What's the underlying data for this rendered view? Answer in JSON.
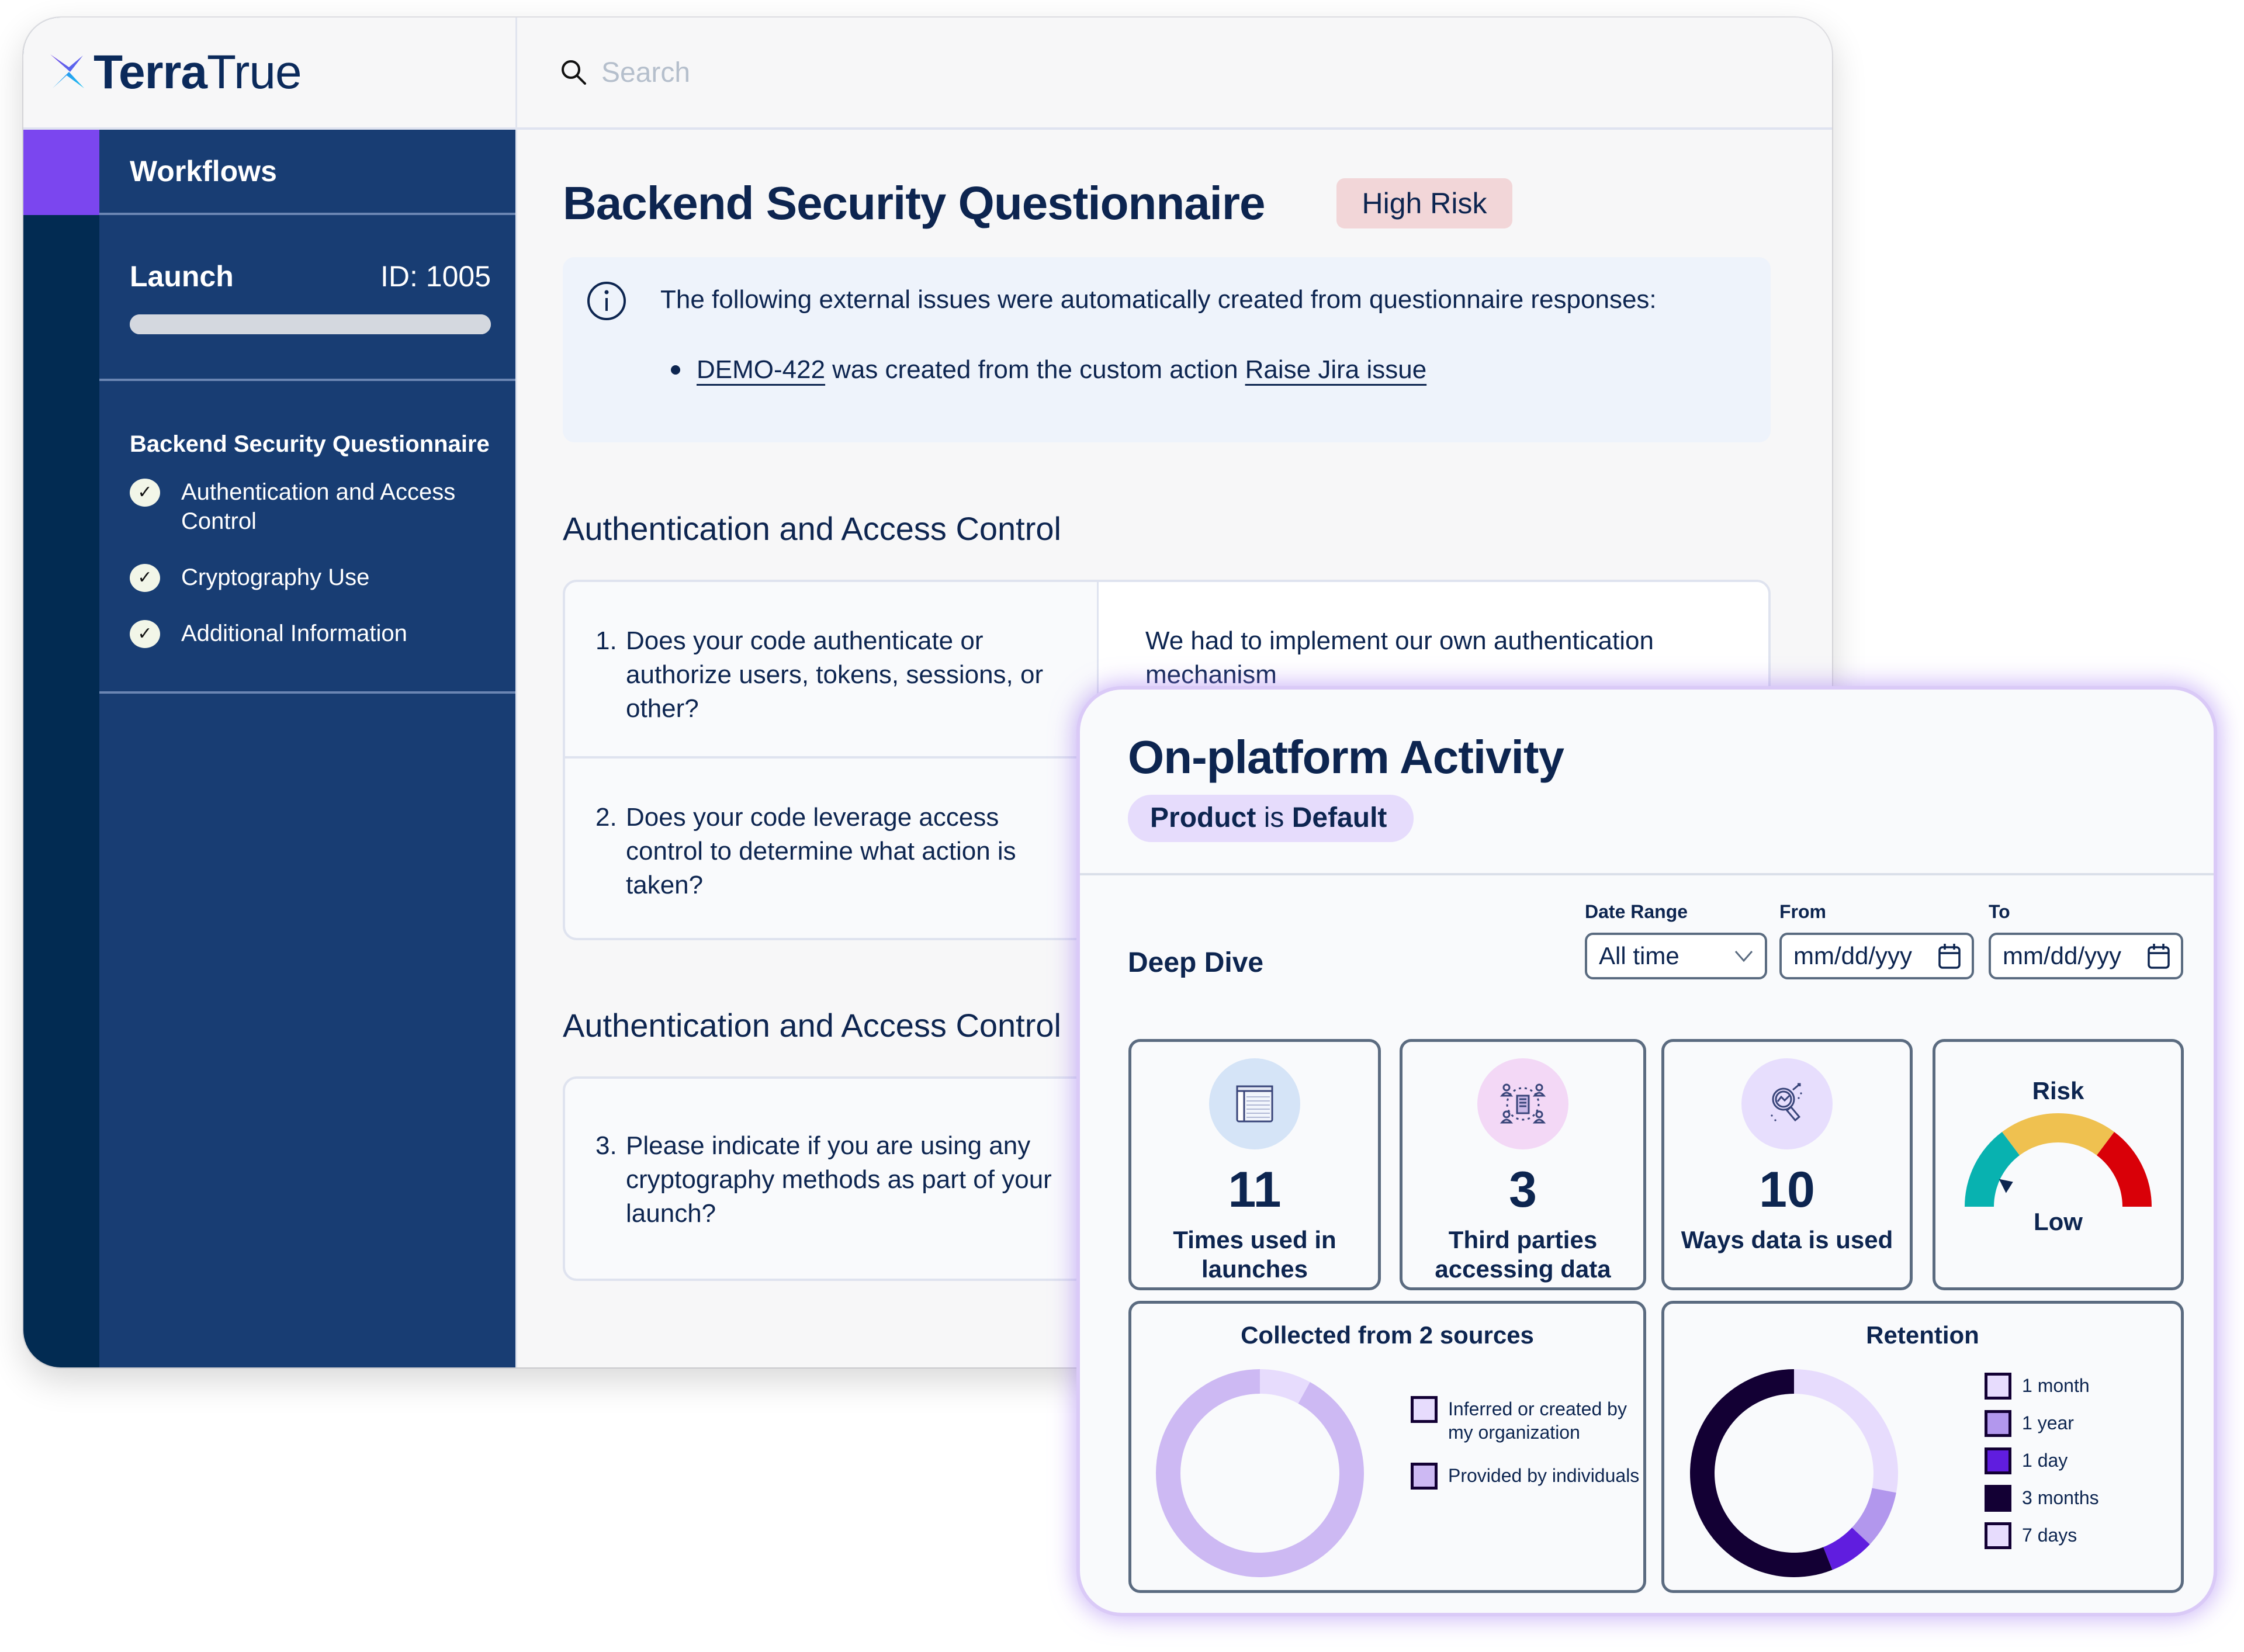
{
  "brand": {
    "logo_bold": "Terra",
    "logo_light": "True",
    "accent_color": "#7b46ef",
    "nav_color": "#183d73"
  },
  "search": {
    "placeholder": "Search",
    "value": ""
  },
  "sidebar": {
    "nav_label": "Workflows",
    "launch_label": "Launch",
    "launch_id": "ID: 1005",
    "launch_progress_percent": 100,
    "section_title": "Backend Security Questionnaire",
    "items": [
      {
        "label": "Authentication and Access Control",
        "checked": true
      },
      {
        "label": "Cryptography Use",
        "checked": true
      },
      {
        "label": "Additional Information",
        "checked": true
      }
    ]
  },
  "page": {
    "title": "Backend Security Questionnaire",
    "risk_badge": "High Risk",
    "info": {
      "message": "The following external issues were automatically created from questionnaire responses:",
      "issue_link": "DEMO-422",
      "issue_text": "was created from the custom action",
      "action_link": "Raise Jira issue"
    },
    "sections": [
      {
        "title": "Authentication and Access Control",
        "questions": [
          {
            "num": "1.",
            "text": "Does your code authenticate or authorize users, tokens, sessions, or other?",
            "answer": "We had to implement our own authentication mechanism"
          },
          {
            "num": "2.",
            "text": "Does your code leverage access control to determine what action is taken?",
            "answer": ""
          }
        ]
      },
      {
        "title": "Authentication and Access Control",
        "questions": [
          {
            "num": "3.",
            "text": "Please indicate if you are using any cryptography methods as part of your launch?",
            "answer": ""
          }
        ]
      }
    ]
  },
  "activity": {
    "title": "On-platform Activity",
    "chip_field": "Product",
    "chip_op": "is",
    "chip_value": "Default",
    "deep_dive": "Deep Dive",
    "filters": {
      "date_range_label": "Date Range",
      "date_range_value": "All time",
      "from_label": "From",
      "from_placeholder": "mm/dd/yyy",
      "to_label": "To",
      "to_placeholder": "mm/dd/yyy"
    },
    "stats": [
      {
        "value": "11",
        "label": "Times used in launches",
        "icon": "table-icon",
        "circle_color": "#d5e4f7"
      },
      {
        "value": "3",
        "label": "Third parties accessing data",
        "icon": "network-icon",
        "circle_color": "#f3d8f6"
      },
      {
        "value": "10",
        "label": "Ways data is used",
        "icon": "magnifier-chart-icon",
        "circle_color": "#e7defd"
      }
    ],
    "risk": {
      "title": "Risk",
      "level": "Low",
      "gauge_value_fraction": 0.12,
      "segments": [
        {
          "name": "low",
          "color": "#08b2b0"
        },
        {
          "name": "medium",
          "color": "#efc150"
        },
        {
          "name": "high",
          "color": "#d90008"
        }
      ]
    }
  },
  "chart_data": [
    {
      "type": "pie",
      "title": "Collected from 2 sources",
      "donut": true,
      "categories": [
        "Inferred or created by my organization",
        "Provided by individuals"
      ],
      "values": [
        8,
        92
      ],
      "colors": [
        "#e7dcfd",
        "#cdb9f3"
      ],
      "legend": "right"
    },
    {
      "type": "pie",
      "title": "Retention",
      "donut": true,
      "categories": [
        "1 month",
        "1 year",
        "1 day",
        "3 months",
        "7 days"
      ],
      "values": [
        28,
        9,
        7,
        56,
        0
      ],
      "colors": [
        "#e7dcfd",
        "#b297ed",
        "#601ddf",
        "#130034",
        "#e7dcfd"
      ],
      "legend": "right"
    }
  ]
}
